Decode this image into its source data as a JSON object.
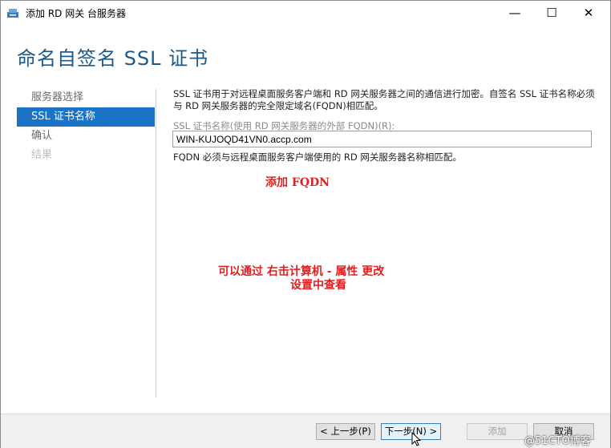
{
  "window": {
    "title": "添加 RD 网关 台服务器",
    "minimize_glyph": "—",
    "maximize_glyph": "☐",
    "close_glyph": "✕"
  },
  "header": {
    "title": "命名自签名 SSL 证书"
  },
  "nav": {
    "items": [
      {
        "label": "服务器选择",
        "state": "normal"
      },
      {
        "label": "SSL 证书名称",
        "state": "active"
      },
      {
        "label": "确认",
        "state": "normal"
      },
      {
        "label": "结果",
        "state": "disabled"
      }
    ]
  },
  "content": {
    "description": "SSL 证书用于对远程桌面服务客户端和 RD 网关服务器之间的通信进行加密。自签名 SSL 证书名称必须与 RD 网关服务器的完全限定域名(FQDN)相匹配。",
    "field_label": "SSL 证书名称(使用 RD 网关服务器的外部 FQDN)(R):",
    "field_value": "WIN-KUJOQD41VN0.accp.com",
    "hint": "FQDN 必须与远程桌面服务客户端使用的 RD 网关服务器名称相匹配。"
  },
  "annotations": {
    "add_fqdn": "添加  FQDN",
    "line1": "可以通过 右击计算机 - 属性 更改",
    "line2": "设置中查看",
    "color": "#e02020"
  },
  "footer": {
    "prev": "< 上一步(P)",
    "next": "下一步(N) >",
    "add": "添加",
    "cancel": "取消"
  },
  "watermark": "@51CTO博客",
  "colors": {
    "accent": "#1a73c5",
    "title": "#1c5a8c"
  }
}
